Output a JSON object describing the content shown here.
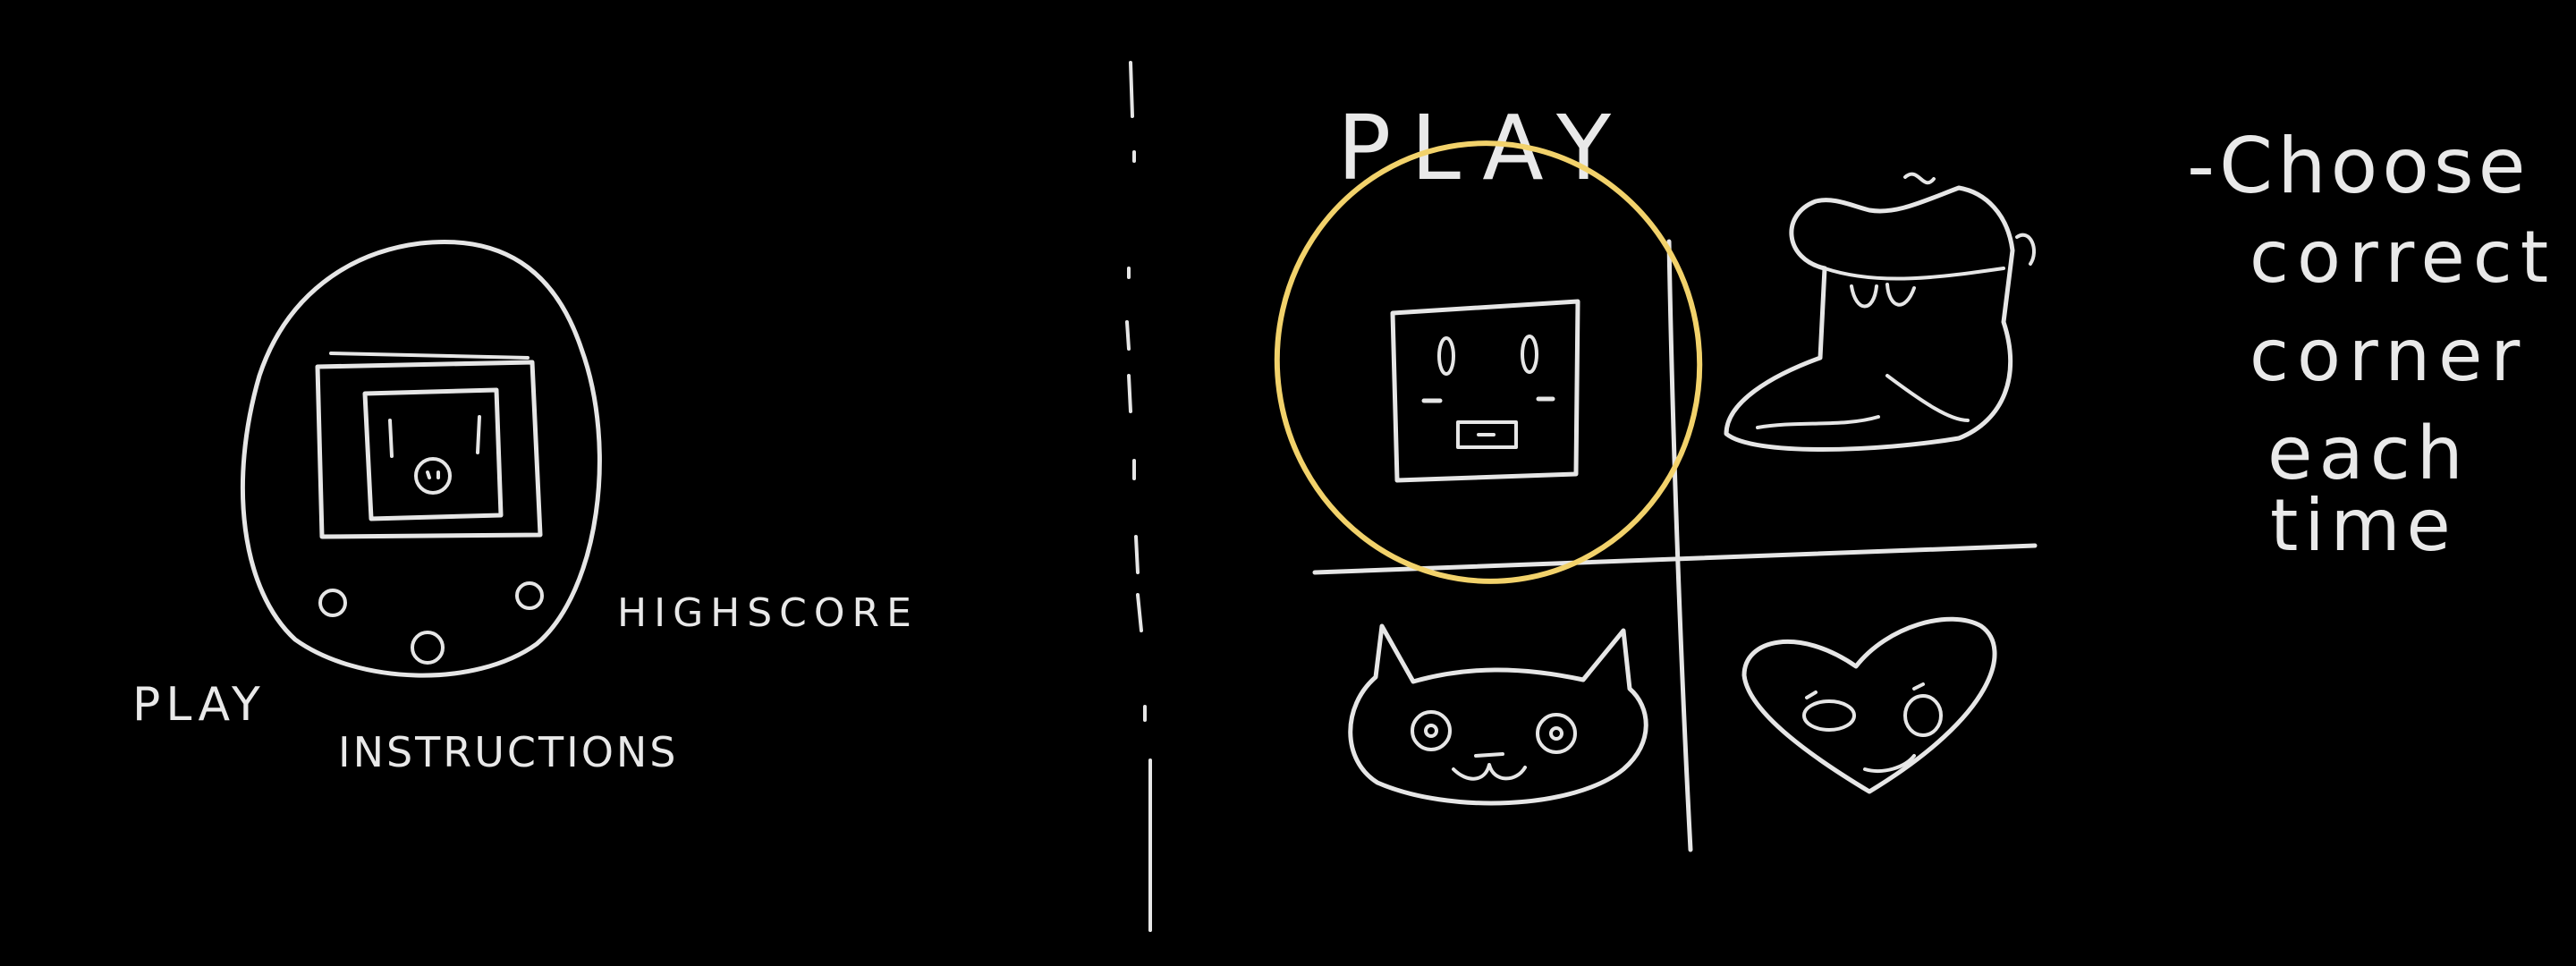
{
  "left_sketch": {
    "labels": {
      "play": "PLAY",
      "instructions": "INSTRUCTIONS",
      "highscore": "HIGHSCORE"
    }
  },
  "right_sketch": {
    "title": "PLAY",
    "quadrants": [
      "square-face",
      "boot",
      "cat",
      "heart"
    ],
    "highlighted_quadrant": "square-face"
  },
  "note": {
    "lines": [
      "-Choose",
      "correct",
      "corner",
      "each",
      "time"
    ]
  },
  "colors": {
    "background": "#000000",
    "ink": "#e6e6e6",
    "highlight": "#f2d26b"
  }
}
